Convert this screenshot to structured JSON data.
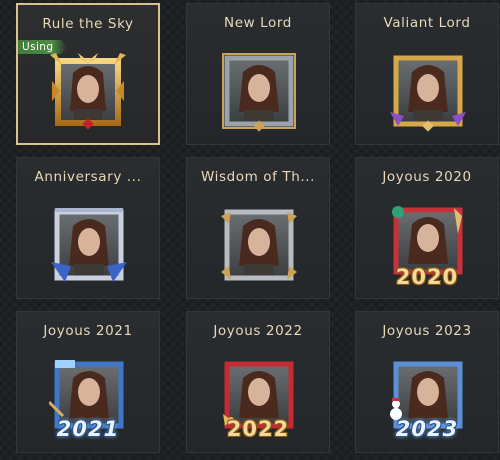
{
  "avatar_frames": [
    {
      "title": "Rule the Sky",
      "status_badge": "Using",
      "selected": true,
      "style": "dragon-gold",
      "icon": "dragon-frame-icon"
    },
    {
      "title": "New Lord",
      "selected": false,
      "style": "steel",
      "icon": "steel-frame-icon"
    },
    {
      "title": "Valiant Lord",
      "selected": false,
      "style": "gold-purple",
      "icon": "gold-frame-icon"
    },
    {
      "title": "Anniversary ...",
      "selected": false,
      "style": "silver-blue",
      "icon": "silver-frame-icon"
    },
    {
      "title": "Wisdom of Th...",
      "selected": false,
      "style": "bronze-steel",
      "icon": "bronze-frame-icon"
    },
    {
      "title": "Joyous 2020",
      "selected": false,
      "style": "festive-red",
      "year_label": "2020",
      "icon": "festive-frame-icon"
    },
    {
      "title": "Joyous 2021",
      "selected": false,
      "style": "ice-blue",
      "year_label": "2021",
      "icon": "ice-frame-icon"
    },
    {
      "title": "Joyous 2022",
      "selected": false,
      "style": "festive-red-gold",
      "year_label": "2022",
      "icon": "festive-frame-icon"
    },
    {
      "title": "Joyous 2023",
      "selected": false,
      "style": "snow-blue",
      "year_label": "2023",
      "icon": "snow-frame-icon"
    }
  ],
  "colors": {
    "title_text": "#e7d9b8",
    "selected_border": "#d9c28d",
    "using_badge": "#4e8c45",
    "card_bg": "#2a2d30"
  }
}
